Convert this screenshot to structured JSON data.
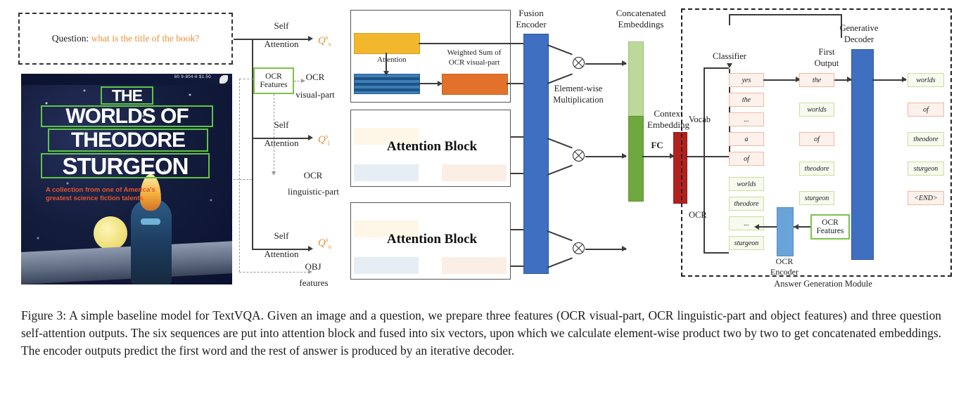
{
  "figure": {
    "question_label": "Question:",
    "question_text": "what is the title of the book?",
    "cover": {
      "isbn": "80 9-804-6 $1.50",
      "title_lines": [
        "THE",
        "WORLDS OF",
        "THEODORE",
        "STURGEON"
      ],
      "subtitle": "A collection from one of America's greatest science fiction talents"
    },
    "self_attention_label": "Self\nAttention",
    "self_attention_line1": "Self",
    "self_attention_line2": "Attention",
    "ocr_features_line1": "OCR",
    "ocr_features_line2": "Features",
    "branches": [
      {
        "q_base": "Q",
        "q_sup": "s",
        "q_sub": "v",
        "feature_line1": "OCR",
        "feature_line2": "visual-part"
      },
      {
        "q_base": "Q",
        "q_sup": "s",
        "q_sub": "l",
        "feature_line1": "OCR",
        "feature_line2": "linguistic-part"
      },
      {
        "q_base": "Q",
        "q_sup": "s",
        "q_sub": "o",
        "feature_line1": "OBJ",
        "feature_line2": "features"
      }
    ],
    "attention_inner": {
      "attention_label": "Attention",
      "weighted_sum_line1": "Weighted Sum of",
      "weighted_sum_line2": "OCR visual-part"
    },
    "attention_block_label": "Attention Block",
    "fusion_encoder_line1": "Fusion",
    "fusion_encoder_line2": "Encoder",
    "elementwise_line1": "Element-wise",
    "elementwise_line2": "Multiplication",
    "concatenated_line1": "Concatenated",
    "concatenated_line2": "Embeddings",
    "fc_label": "FC",
    "context_line1": "Context",
    "context_line2": "Embedding",
    "classifier_label": "Classifier",
    "vocab_label": "Vocab",
    "ocr_label": "OCR",
    "vocab_items": [
      "yes",
      "the",
      "...",
      "a",
      "of"
    ],
    "ocr_items": [
      "worlds",
      "theodore",
      "...",
      "sturgeon"
    ],
    "first_output_line1": "First",
    "first_output_line2": "Output",
    "first_output_items": [
      "the",
      "worlds",
      "of",
      "theodore",
      "sturgeon"
    ],
    "first_output_item_kinds": [
      "vocab",
      "ocr",
      "vocab",
      "ocr",
      "ocr"
    ],
    "generative_decoder_line1": "Generative",
    "generative_decoder_line2": "Decoder",
    "decoder_output_items": [
      "worlds",
      "of",
      "theodore",
      "sturgeon",
      "<END>"
    ],
    "decoder_output_item_kinds": [
      "ocr",
      "vocab",
      "ocr",
      "ocr",
      "vocab"
    ],
    "ocr_encoder_line1": "OCR",
    "ocr_encoder_line2": "Encoder",
    "answer_generation_module_label": "Answer Generation Module",
    "colors": {
      "question_text": "#e8913a",
      "ocr_green": "#7cc24a",
      "yellow": "#f3b72e",
      "blue_stripe": "#2e6fa8",
      "orange": "#e2722b",
      "fusion_blue": "#3f6fc0",
      "concat_green_light": "#bcd99a",
      "concat_green_dark": "#6fa83f",
      "context_red": "#b3201d",
      "ocr_encoder_blue": "#6aa3d8"
    }
  },
  "caption": "Figure 3: A simple baseline model for TextVQA. Given an image and a question, we prepare three features (OCR visual-part, OCR linguistic-part and object features) and three question self-attention outputs. The six sequences are put into attention block and fused into six vectors, upon which we calculate element-wise product two by two to get concatenated embeddings. The encoder outputs predict the first word and the rest of answer is produced by an iterative decoder."
}
